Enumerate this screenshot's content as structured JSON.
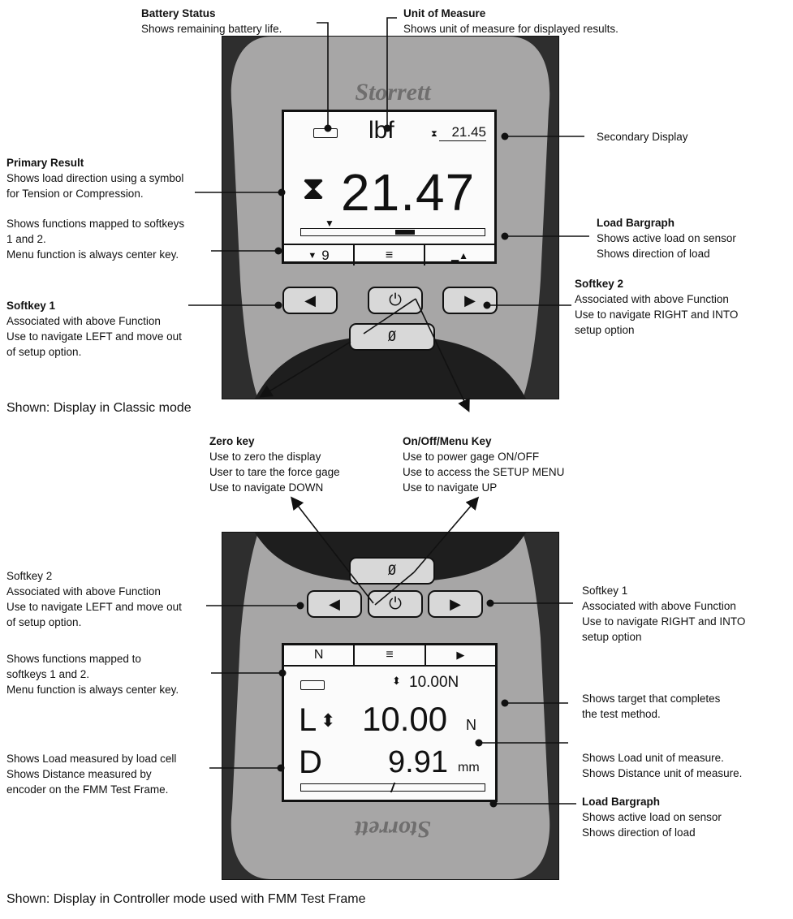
{
  "colors": {
    "case_dark": "#2e2e2e",
    "face": "#a7a6a6",
    "lcd_bg": "#fbfbfb",
    "key": "#d8d8d8",
    "ink": "#111111"
  },
  "callouts": {
    "battery": {
      "title": "Battery Status",
      "desc": "Shows remaining battery life."
    },
    "unit": {
      "title": "Unit of Measure",
      "desc": "Shows unit of measure for displayed results."
    },
    "secondary": {
      "desc": "Secondary Display"
    },
    "primary": {
      "title": "Primary Result",
      "line1": "Shows load direction using a symbol",
      "line2": "for Tension or Compression."
    },
    "softfunc1": {
      "line1": "Shows functions mapped to softkeys",
      "line2": "1 and 2.",
      "line3": "Menu function is always center key."
    },
    "bargraph1": {
      "title": "Load Bargraph",
      "line1": "Shows active load on sensor",
      "line2": "Shows direction of load"
    },
    "softkey2_top": {
      "title": "Softkey 2",
      "line1": "Associated with above Function",
      "line2": "Use to navigate RIGHT and INTO",
      "line3": "setup option"
    },
    "softkey1_top": {
      "title": "Softkey 1",
      "line1": "Associated with above Function",
      "line2": "Use to navigate LEFT and move out",
      "line3": "of setup option."
    },
    "classic_caption": "Shown: Display in Classic mode",
    "zero": {
      "title": "Zero key",
      "line1": "Use to zero the display",
      "line2": "User to tare the force gage",
      "line3": "Use to navigate DOWN"
    },
    "onoff": {
      "title": "On/Off/Menu Key",
      "line1": "Use to power gage ON/OFF",
      "line2": "Use to access the SETUP MENU",
      "line3": "Use to navigate UP"
    },
    "softkey2_bot": {
      "line0": "Softkey 2",
      "line1": "Associated with above Function",
      "line2": "Use to navigate LEFT and move out",
      "line3": "of setup option."
    },
    "softkey1_bot": {
      "line0": "Softkey 1",
      "line1": "Associated with above Function",
      "line2": "Use to navigate RIGHT and INTO",
      "line3": "setup option"
    },
    "softfunc2": {
      "line1": "Shows functions mapped to",
      "line2": "softkeys 1 and 2.",
      "line3": "Menu function is always center key."
    },
    "target": {
      "line1": "Shows target that completes",
      "line2": "the test method."
    },
    "loadcell": {
      "line1": "Shows Load measured by load cell",
      "line2": "Shows Distance measured by",
      "line3": "encoder on the FMM Test Frame."
    },
    "units2": {
      "line1": "Shows Load unit of measure.",
      "line2": "Shows Distance unit of measure."
    },
    "bargraph2": {
      "title": "Load Bargraph",
      "line1": "Shows active load on sensor",
      "line2": "Shows direction of load"
    },
    "controller_caption": "Shown: Display in Controller mode used with FMM Test Frame"
  },
  "device_top": {
    "brand": "Storrett",
    "unit": "lbf",
    "secondary_value": "21.45",
    "primary_value": "21.47",
    "softkey_left_value": "9",
    "zero_key": "Ø"
  },
  "device_bottom": {
    "brand": "Storrett",
    "softkey_left": "N",
    "target_value": "10.00N",
    "load_label": "L",
    "load_value": "10.00",
    "load_unit": "N",
    "distance_label": "D",
    "distance_value": "9.91",
    "distance_unit": "mm",
    "zero_key": "Ø"
  }
}
